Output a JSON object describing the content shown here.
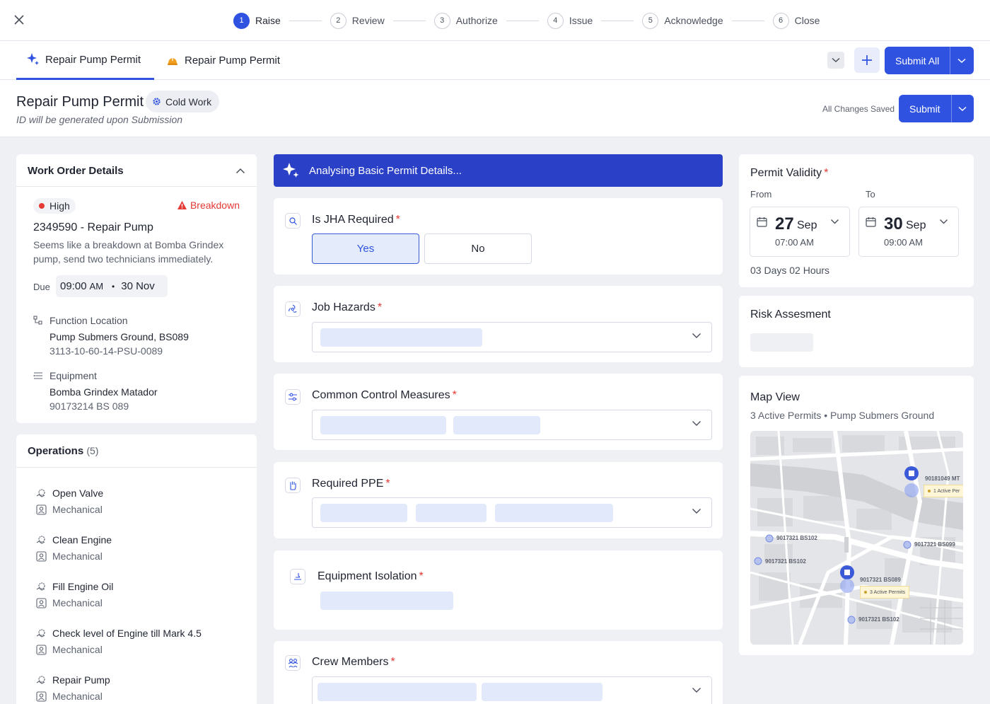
{
  "stepper": {
    "steps": [
      {
        "num": "1",
        "label": "Raise"
      },
      {
        "num": "2",
        "label": "Review"
      },
      {
        "num": "3",
        "label": "Authorize"
      },
      {
        "num": "4",
        "label": "Issue"
      },
      {
        "num": "5",
        "label": "Acknowledge"
      },
      {
        "num": "6",
        "label": "Close"
      }
    ],
    "active": 0
  },
  "tabs": [
    {
      "label": "Repair Pump Permit",
      "icon": "sparkle-icon"
    },
    {
      "label": "Repair Pump Permit",
      "icon": "hard-hat-icon"
    }
  ],
  "toolbar": {
    "submit_all_label": "Submit All"
  },
  "header": {
    "title": "Repair Pump Permit",
    "chip": "Cold Work",
    "subtitle": "ID will be generated upon Submission",
    "saved": "All Changes Saved",
    "submit_label": "Submit"
  },
  "work_order": {
    "heading": "Work Order Details",
    "priority": "High",
    "type": "Breakdown",
    "title": "2349590 - Repair Pump",
    "description": "Seems like a breakdown at Bomba Grindex pump, send two technicians immediately.",
    "due_label": "Due",
    "due_time": "09:00",
    "due_ampm": "AM",
    "due_date": "30 Nov",
    "function_location": {
      "label": "Function Location",
      "name": "Pump Submers Ground, BS089",
      "code": "3113-10-60-14-PSU-0089"
    },
    "equipment": {
      "label": "Equipment",
      "name": "Bomba Grindex Matador",
      "code": "90173214 BS 089"
    }
  },
  "operations": {
    "heading": "Operations",
    "count": "(5)",
    "items": [
      {
        "name": "Open Valve",
        "category": "Mechanical"
      },
      {
        "name": "Clean Engine",
        "category": "Mechanical"
      },
      {
        "name": "Fill Engine Oil",
        "category": "Mechanical"
      },
      {
        "name": "Check level of Engine till Mark 4.5",
        "category": "Mechanical"
      },
      {
        "name": "Repair Pump",
        "category": "Mechanical"
      }
    ]
  },
  "analysis": {
    "banner": "Analysing Basic Permit Details..."
  },
  "questions": {
    "jha": {
      "label": "Is JHA Required",
      "yes": "Yes",
      "no": "No",
      "selected": "Yes"
    },
    "hazards": {
      "label": "Job Hazards"
    },
    "controls": {
      "label": "Common Control Measures"
    },
    "ppe": {
      "label": "Required PPE"
    },
    "isolation": {
      "label": "Equipment Isolation"
    },
    "crew": {
      "label": "Crew Members"
    },
    "required_mark": "*"
  },
  "validity": {
    "title": "Permit Validity",
    "from_label": "From",
    "to_label": "To",
    "from": {
      "day": "27",
      "month": "Sep",
      "time": "07:00 AM"
    },
    "to": {
      "day": "30",
      "month": "Sep",
      "time": "09:00 AM"
    },
    "duration": "03 Days 02 Hours"
  },
  "risk": {
    "title": "Risk Assesment"
  },
  "map": {
    "title": "Map View",
    "subtitle": "3 Active Permits • Pump Submers Ground",
    "labels": {
      "l1": "90181049 MT",
      "l1_tag": "1 Active Per",
      "l2": "9017321 BS102",
      "l3": "9017321 BS099",
      "l4": "9017321 BS102",
      "l5": "9017321 BS089",
      "l5_tag": "3 Active Permits",
      "l6": "9017321 BS102"
    }
  },
  "colors": {
    "accent": "#2f52e0",
    "banner": "#2a40c6",
    "danger": "#e53935"
  }
}
